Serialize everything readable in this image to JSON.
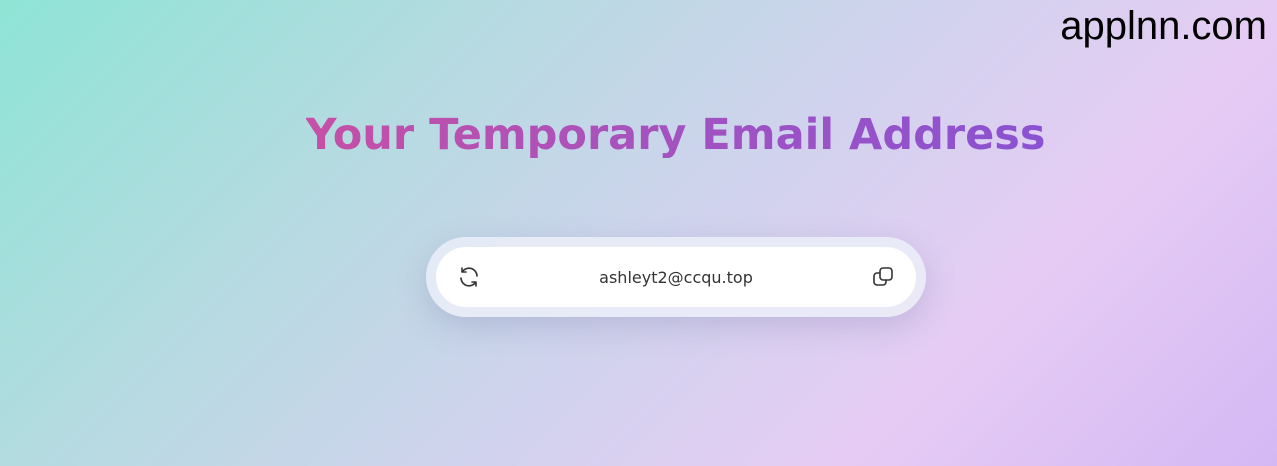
{
  "watermark": "applnn.com",
  "page_title": "Your Temporary Email Address",
  "email_box": {
    "address": "ashleyt2@ccqu.top",
    "refresh_icon": "refresh-icon",
    "copy_icon": "copy-icon"
  },
  "colors": {
    "title_gradient_start": "#c650a6",
    "title_gradient_end": "#8a52d2",
    "background_start": "#8ee4d6",
    "background_end": "#d3b8f4",
    "email_text": "#333333"
  }
}
